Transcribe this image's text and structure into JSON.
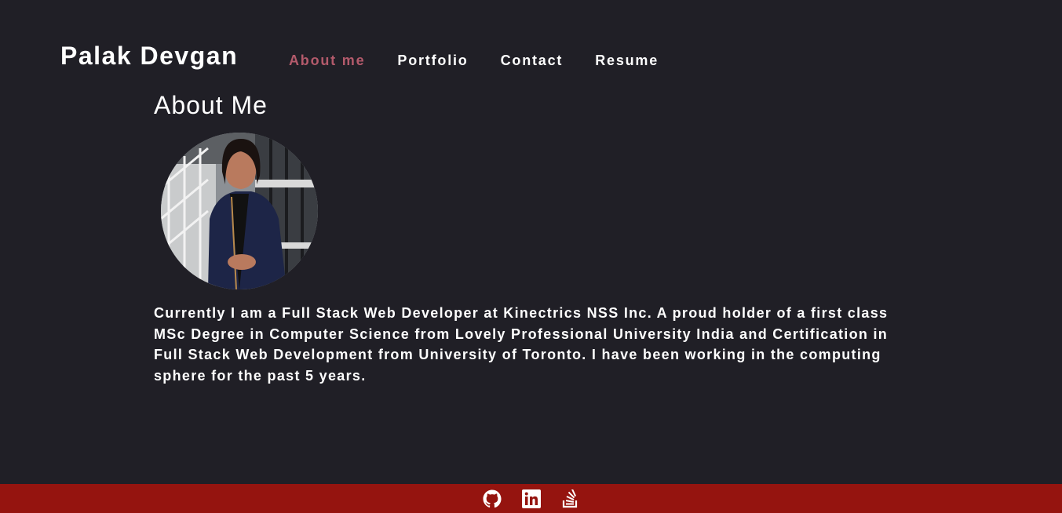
{
  "header": {
    "brand": "Palak Devgan",
    "nav": [
      {
        "label": "About me",
        "active": true
      },
      {
        "label": "Portfolio",
        "active": false
      },
      {
        "label": "Contact",
        "active": false
      },
      {
        "label": "Resume",
        "active": false
      }
    ]
  },
  "main": {
    "title": "About Me",
    "bio": "Currently I am a Full Stack Web Developer at Kinectrics NSS Inc. A proud holder of a first class MSc Degree in Computer Science from Lovely Professional University India and Certification in Full Stack Web Development from University of Toronto. I have been working in the computing sphere for the past 5 years."
  },
  "footer": {
    "icons": [
      "github-icon",
      "linkedin-icon",
      "stackoverflow-icon"
    ]
  },
  "colors": {
    "background": "#201f26",
    "active_nav": "#b35a6b",
    "footer": "#95140f",
    "text": "#ffffff"
  }
}
